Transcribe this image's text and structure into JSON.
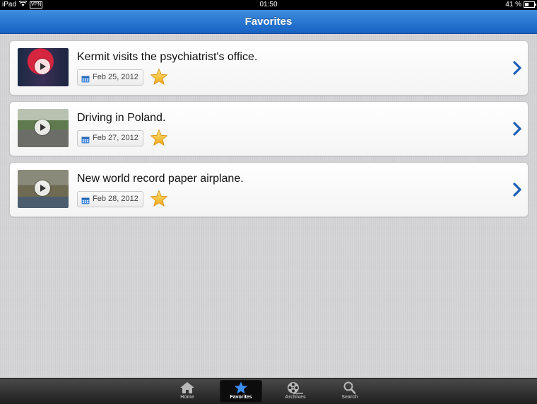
{
  "status": {
    "device": "iPad",
    "vpn": "VPN",
    "time": "01:50",
    "battery": "41 %"
  },
  "navbar": {
    "title": "Favorites"
  },
  "favorites": [
    {
      "title": "Kermit visits the psychiatrist's office.",
      "date": "Feb 25, 2012",
      "thumb": "kermit"
    },
    {
      "title": "Driving in Poland.",
      "date": "Feb 27, 2012",
      "thumb": "road"
    },
    {
      "title": "New world record paper airplane.",
      "date": "Feb 28, 2012",
      "thumb": "room"
    }
  ],
  "tabs": [
    {
      "label": "Home",
      "icon": "home-icon"
    },
    {
      "label": "Favorites",
      "icon": "star-icon",
      "active": true
    },
    {
      "label": "Archives",
      "icon": "film-reel-icon"
    },
    {
      "label": "Search",
      "icon": "search-icon"
    }
  ],
  "colors": {
    "navbar": "#1f6fd0",
    "accent_chevron": "#1d5fb8",
    "star": "#f5b923"
  }
}
